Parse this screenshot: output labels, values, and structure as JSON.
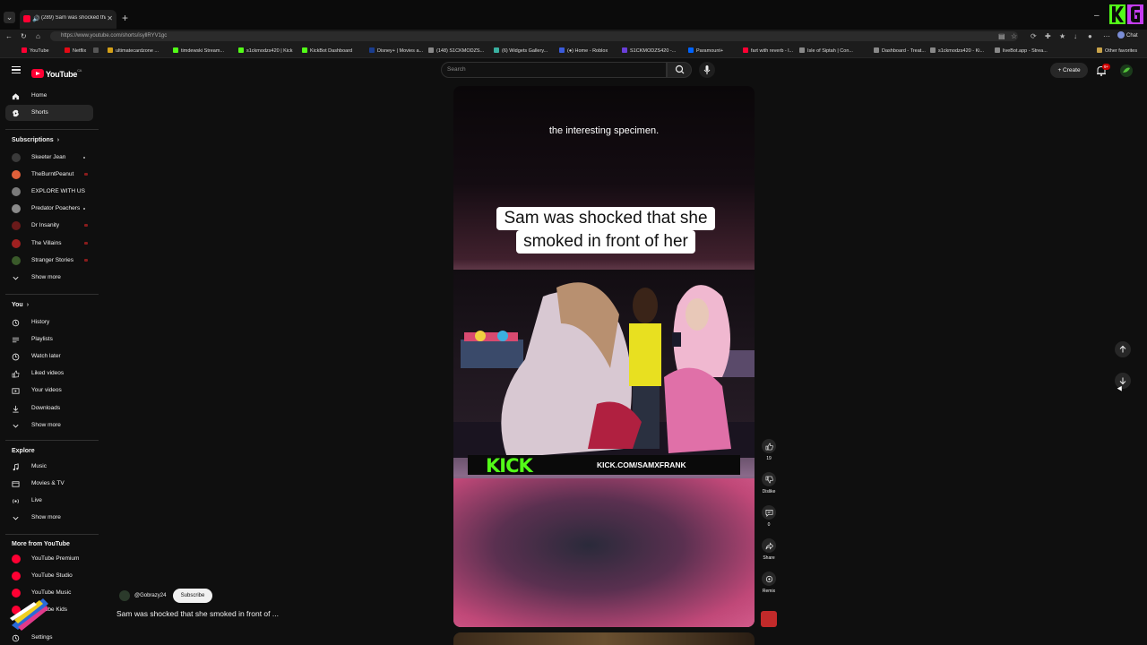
{
  "browser": {
    "tab_title": "(289) Sam was shocked that s",
    "url": "https://www.youtube.com/shorts/isyllRYV1gc",
    "profile_label": "Chat",
    "bookmarks": [
      {
        "label": "YouTube",
        "color": "#ff0033"
      },
      {
        "label": "Netflix",
        "color": "#e50914"
      },
      {
        "label": "",
        "color": "#555555"
      },
      {
        "label": "ultimatecardzone ...",
        "color": "#d4a017"
      },
      {
        "label": "timdewski Stream...",
        "color": "#53fc18"
      },
      {
        "label": "s1ckmodzs420 | Kick",
        "color": "#53fc18"
      },
      {
        "label": "KickBot Dashboard",
        "color": "#53fc18"
      },
      {
        "label": "Disney+ | Movies a...",
        "color": "#1a3d8f"
      },
      {
        "label": "(148) S1CKMODZS...",
        "color": "#888888"
      },
      {
        "label": "(6) Widgets Gallery...",
        "color": "#3ab0a0"
      },
      {
        "label": "(●) Home - Roblox",
        "color": "#3b5bdb"
      },
      {
        "label": "S1CKMODZS420 -...",
        "color": "#6a3fd8"
      },
      {
        "label": "Paramount+",
        "color": "#0064ff"
      },
      {
        "label": "fart with reverb - l...",
        "color": "#ff0033"
      },
      {
        "label": "Isle of Siptah | Con...",
        "color": "#888888"
      },
      {
        "label": "Dashboard - Treat...",
        "color": "#888888"
      },
      {
        "label": "s1ckmodzs420 - Ki...",
        "color": "#888888"
      },
      {
        "label": "liveBot.app - Strea...",
        "color": "#888888"
      }
    ],
    "other_favorites": "Other favorites"
  },
  "header": {
    "logo": "YouTube",
    "logo_region": "CA",
    "search_placeholder": "Search",
    "create_label": "Create",
    "notification_count": "9+"
  },
  "sidebar": {
    "top": [
      {
        "label": "Home",
        "icon": "home-icon"
      },
      {
        "label": "Shorts",
        "icon": "shorts-icon",
        "active": true
      }
    ],
    "subscriptions_heading": "Subscriptions",
    "subscriptions": [
      {
        "label": "Skeeter Jean",
        "color": "#3a3a3a",
        "indicator": "dot"
      },
      {
        "label": "TheBurntPeanut",
        "color": "#e0603a",
        "indicator": "live"
      },
      {
        "label": "EXPLORE WITH US",
        "color": "#7a7a7a",
        "indicator": ""
      },
      {
        "label": "Predator Poachers",
        "color": "#8a8a8a",
        "indicator": "dot"
      },
      {
        "label": "Dr Insanity",
        "color": "#6a1a1a",
        "indicator": "live"
      },
      {
        "label": "The Villains",
        "color": "#a02020",
        "indicator": "live"
      },
      {
        "label": "Stranger Stories",
        "color": "#3a5a2a",
        "indicator": "live"
      }
    ],
    "show_more": "Show more",
    "you_heading": "You",
    "you_items": [
      {
        "label": "History",
        "icon": "history-icon"
      },
      {
        "label": "Playlists",
        "icon": "playlists-icon"
      },
      {
        "label": "Watch later",
        "icon": "watch-later-icon"
      },
      {
        "label": "Liked videos",
        "icon": "liked-icon"
      },
      {
        "label": "Your videos",
        "icon": "your-videos-icon"
      },
      {
        "label": "Downloads",
        "icon": "downloads-icon"
      },
      {
        "label": "Show more",
        "icon": "chevron-down-icon"
      }
    ],
    "explore_heading": "Explore",
    "explore_items": [
      {
        "label": "Music",
        "icon": "music-icon"
      },
      {
        "label": "Movies & TV",
        "icon": "movies-icon"
      },
      {
        "label": "Live",
        "icon": "live-icon"
      },
      {
        "label": "Show more",
        "icon": "chevron-down-icon"
      }
    ],
    "more_heading": "More from YouTube",
    "more_items": [
      {
        "label": "YouTube Premium"
      },
      {
        "label": "YouTube Studio"
      },
      {
        "label": "YouTube Music"
      },
      {
        "label": "YouTube Kids"
      }
    ],
    "settings_label": "Settings"
  },
  "video": {
    "caption_top": "the interesting specimen.",
    "caption_line1": "Sam was shocked that she",
    "caption_line2": "smoked in front of her",
    "kick_logo": "KICK",
    "kick_url": "KICK.COM/SAMXFRANK",
    "channel": "@Gobrazy24",
    "subscribe": "Subscribe",
    "title": "Sam was shocked that she smoked in front of ..."
  },
  "actions": {
    "like_count": "19",
    "dislike_label": "Dislike",
    "comment_count": "0",
    "share_label": "Share",
    "remix_label": "Remix"
  }
}
